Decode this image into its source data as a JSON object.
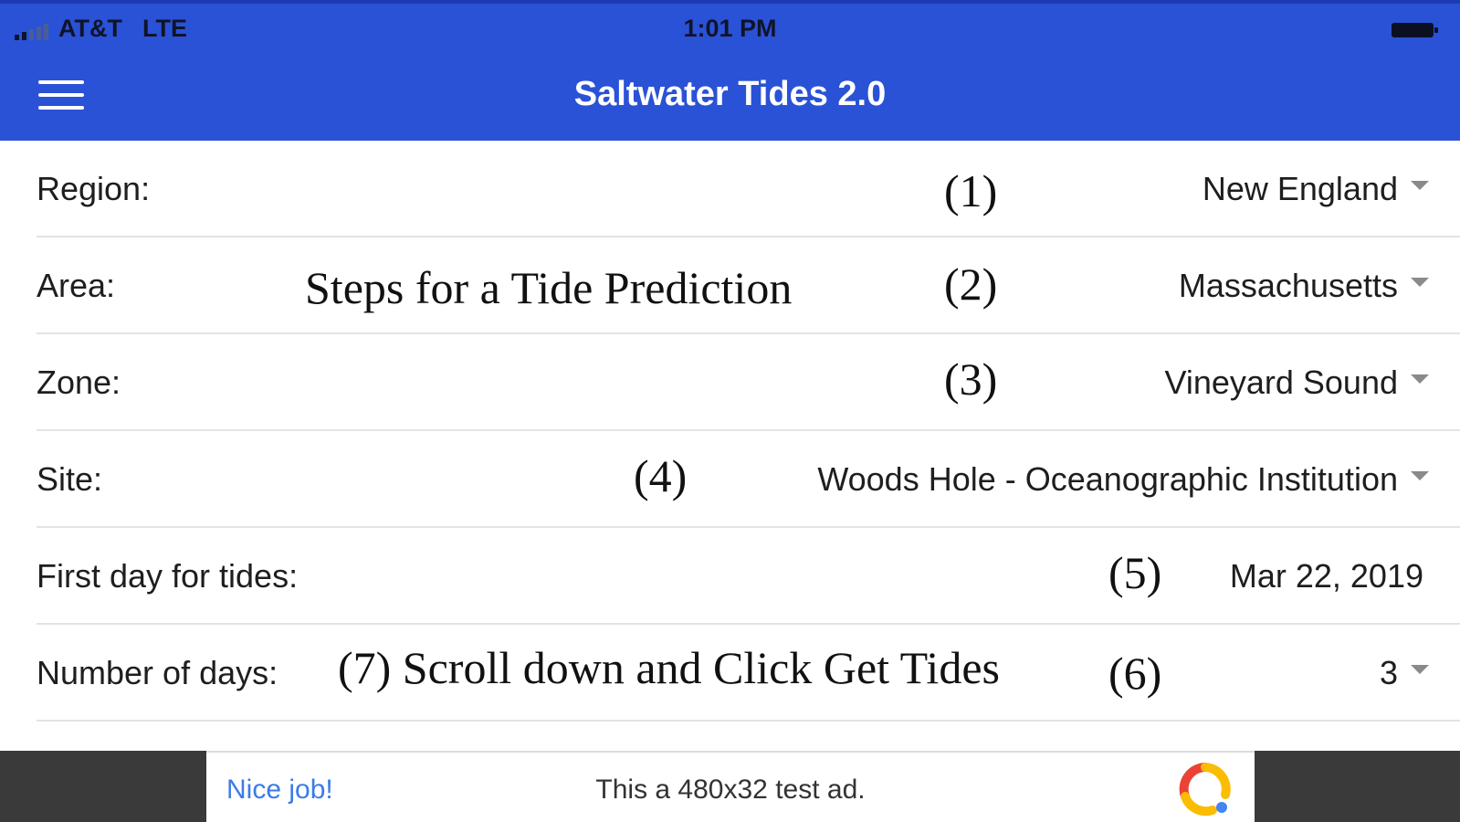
{
  "status_bar": {
    "carrier": "AT&T",
    "network": "LTE",
    "time": "1:01 PM",
    "icons": [
      "signal-icon",
      "battery-icon"
    ]
  },
  "header": {
    "menu_icon": "hamburger-menu-icon",
    "title": "Saltwater Tides 2.0",
    "color": "#2a52d6"
  },
  "form": {
    "region": {
      "label": "Region:",
      "value": "New England"
    },
    "area": {
      "label": "Area:",
      "value": "Massachusetts"
    },
    "zone": {
      "label": "Zone:",
      "value": "Vineyard Sound"
    },
    "site": {
      "label": "Site:",
      "value": "Woods Hole - Oceanographic Institution"
    },
    "first_day": {
      "label": "First day for tides:",
      "value": "Mar 22, 2019"
    },
    "num_days": {
      "label": "Number of days:",
      "value": "3"
    }
  },
  "annotations": {
    "title": "Steps for a Tide Prediction",
    "step1": "(1)",
    "step2": "(2)",
    "step3": "(3)",
    "step4": "(4)",
    "step5": "(5)",
    "step6": "(6)",
    "step7": "(7) Scroll down and Click Get Tides"
  },
  "ad": {
    "nice": "Nice job!",
    "text": "This a 480x32 test ad.",
    "logo_icon": "ad-logo-icon"
  }
}
